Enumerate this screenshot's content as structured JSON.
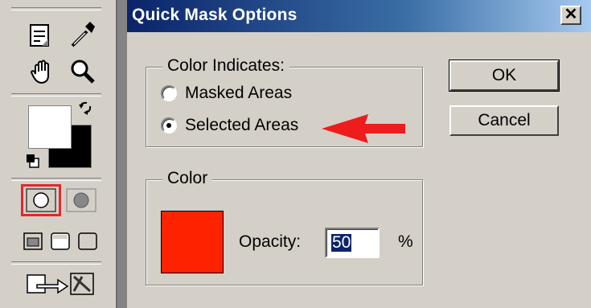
{
  "dialog": {
    "title": "Quick Mask Options",
    "close_glyph": "✕",
    "color_indicates": {
      "legend": "Color Indicates:",
      "options": [
        {
          "label": "Masked Areas",
          "selected": false
        },
        {
          "label": "Selected Areas",
          "selected": true
        }
      ]
    },
    "color_group": {
      "legend": "Color",
      "swatch_color": "#ff2200",
      "opacity_label": "Opacity:",
      "opacity_value": "50",
      "percent": "%"
    },
    "buttons": {
      "ok": "OK",
      "cancel": "Cancel"
    }
  },
  "annotation": {
    "arrow_color": "#ee1c1c"
  },
  "toolbox": {
    "highlight_color": "#e8262a",
    "tools": [
      "notes-tool",
      "eyedropper-tool",
      "hand-tool",
      "zoom-tool",
      "foreground-color",
      "background-color",
      "swap-colors",
      "default-colors",
      "standard-mode",
      "quick-mask-mode",
      "screen-mode-standard",
      "screen-mode-full-menu",
      "screen-mode-full",
      "jump-to-imageready"
    ]
  }
}
